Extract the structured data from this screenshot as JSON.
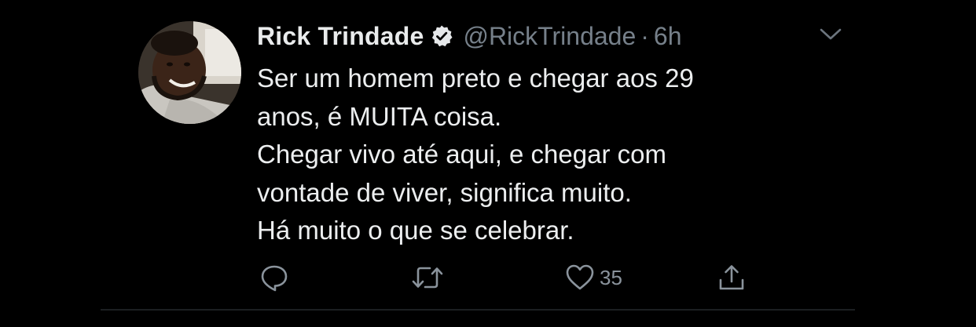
{
  "tweet": {
    "author": {
      "display_name": "Rick Trindade",
      "handle": "@RickTrindade",
      "verified": true,
      "avatar_icon": "profile-photo"
    },
    "separator": "·",
    "timestamp": "6h",
    "menu_icon": "chevron-down-icon",
    "lines": [
      "Ser um homem preto e chegar aos 29",
      "anos, é MUITA coisa.",
      "Chegar vivo até aqui, e chegar com",
      "vontade de viver, significa muito.",
      "Há muito o que se celebrar."
    ],
    "actions": {
      "reply_icon": "reply-icon",
      "retweet_icon": "retweet-icon",
      "like_icon": "heart-icon",
      "like_count": "35",
      "share_icon": "share-icon"
    },
    "colors": {
      "background": "#000000",
      "text": "#eceeef",
      "muted": "#76808a",
      "icon": "#8a939c"
    }
  }
}
